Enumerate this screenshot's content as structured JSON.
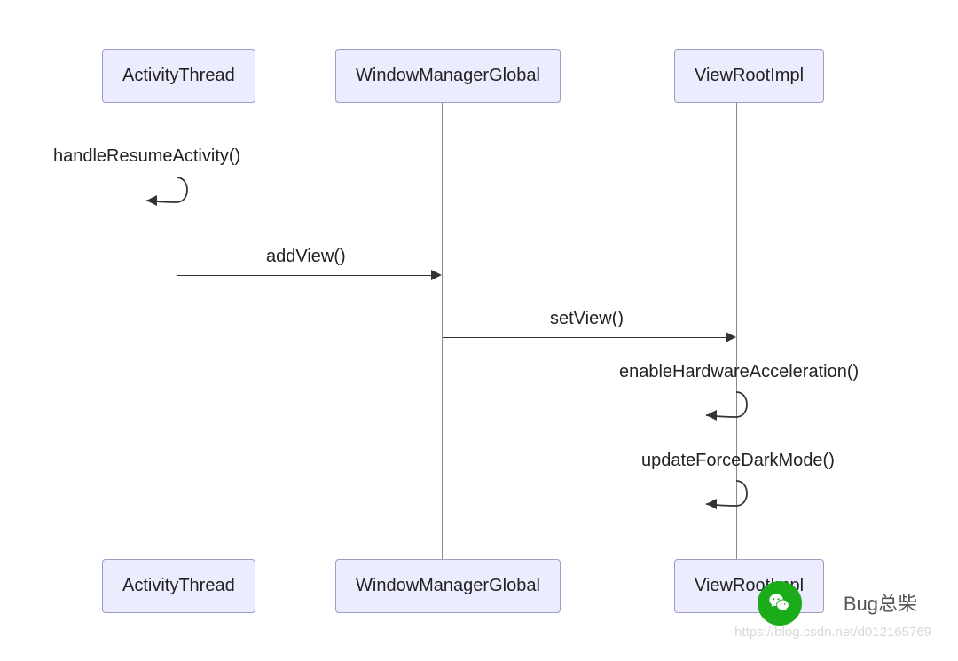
{
  "participants": {
    "p0": "ActivityThread",
    "p1": "WindowManagerGlobal",
    "p2": "ViewRootImpl"
  },
  "messages": {
    "m0": "handleResumeActivity()",
    "m1": "addView()",
    "m2": "setView()",
    "m3": "enableHardwareAcceleration()",
    "m4": "updateForceDarkMode()"
  },
  "watermark": {
    "text": "Bug总柴",
    "url": "https://blog.csdn.net/d012165769"
  },
  "chart_data": {
    "type": "sequence-diagram",
    "participants": [
      "ActivityThread",
      "WindowManagerGlobal",
      "ViewRootImpl"
    ],
    "interactions": [
      {
        "from": "ActivityThread",
        "to": "ActivityThread",
        "label": "handleResumeActivity()",
        "kind": "self"
      },
      {
        "from": "ActivityThread",
        "to": "WindowManagerGlobal",
        "label": "addView()",
        "kind": "sync"
      },
      {
        "from": "WindowManagerGlobal",
        "to": "ViewRootImpl",
        "label": "setView()",
        "kind": "sync"
      },
      {
        "from": "ViewRootImpl",
        "to": "ViewRootImpl",
        "label": "enableHardwareAcceleration()",
        "kind": "self"
      },
      {
        "from": "ViewRootImpl",
        "to": "ViewRootImpl",
        "label": "updateForceDarkMode()",
        "kind": "self"
      }
    ]
  }
}
